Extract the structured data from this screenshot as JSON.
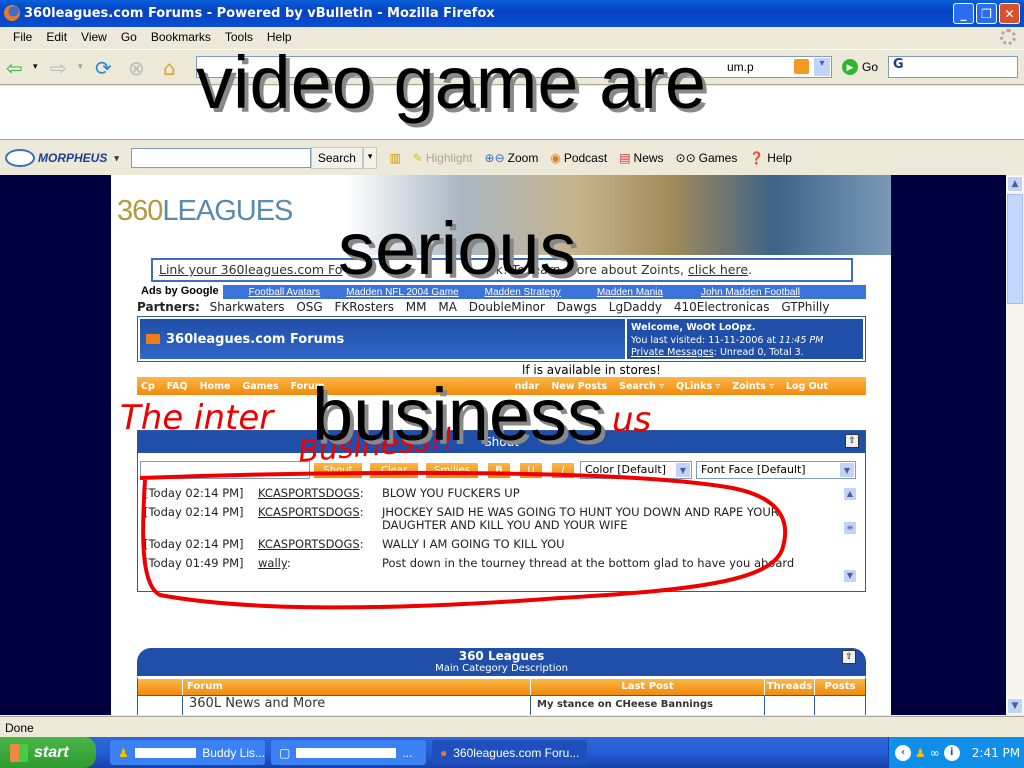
{
  "window": {
    "title": "360leagues.com Forums - Powered by vBulletin - Mozilla Firefox",
    "controls": [
      "minimize",
      "restore",
      "close"
    ]
  },
  "menu": [
    "File",
    "Edit",
    "View",
    "Go",
    "Bookmarks",
    "Tools",
    "Help"
  ],
  "navbar": {
    "url_visible_fragment": "um.p",
    "go_label": "Go",
    "search_engine_icon": "G"
  },
  "morpheus": {
    "brand": "MORPHEUS",
    "search_value": "",
    "search_button": "Search",
    "items": [
      {
        "icon": "toolbar-icon",
        "label": ""
      },
      {
        "icon": "highlight-icon",
        "label": "Highlight"
      },
      {
        "icon": "zoom-icon",
        "label": "Zoom"
      },
      {
        "icon": "podcast-icon",
        "label": "Podcast"
      },
      {
        "icon": "news-icon",
        "label": "News"
      },
      {
        "icon": "games-icon",
        "label": "Games"
      },
      {
        "icon": "help-icon",
        "label": "Help"
      }
    ]
  },
  "page": {
    "logo": {
      "a": "360",
      "b": "LEAGUES"
    },
    "zoints": {
      "text_visible": "Link your 360leagues.com Fo",
      "text_hidden_mid": "rum ... to the Zoints network",
      "text_tail": "rk! To learn more about Zoints, ",
      "link": "click here",
      "end": "."
    },
    "ads": {
      "label": "Ads by Google",
      "links": [
        "Football Avatars",
        "Madden NFL 2004 Game",
        "Madden Strategy",
        "Madden Mania",
        "John Madden Football"
      ]
    },
    "partners": {
      "label": "Partners:",
      "items": [
        "Sharkwaters",
        "OSG",
        "FKRosters",
        "MM",
        "MA",
        "DoubleMinor",
        "Dawgs",
        "LgDaddy",
        "410Electronicas",
        "GTPhilly"
      ]
    },
    "forum_header": {
      "title": "360leagues.com Forums",
      "welcome": "Welcome, WoOt LoOpz.",
      "last_visited_label": "You last visited: 11-11-2006 at ",
      "last_visited_time": "11:45 PM",
      "pm_link": "Private Messages",
      "pm_status": ": Unread 0, Total 3."
    },
    "notice_tail": "lf is available in stores!",
    "nav": [
      "Cp",
      "FAQ",
      "Home",
      "Games",
      "Forum",
      "",
      "",
      "ndar",
      "New Posts",
      "Search ▿",
      "QLinks ▿",
      "Zoints ▿",
      "Log Out"
    ],
    "shoutbox": {
      "title": "Shout",
      "input_value": "",
      "buttons": [
        "Shout",
        "Clear",
        "Smilies",
        "B",
        "U",
        "I"
      ],
      "color_select": "Color [Default]",
      "font_select": "Font Face [Default]",
      "messages": [
        {
          "time": "[Today 02:14 PM]",
          "user": "KCASPORTSDOGS",
          "text": "BLOW YOU FUCKERS UP"
        },
        {
          "time": "[Today 02:14 PM]",
          "user": "KCASPORTSDOGS",
          "text": "JHOCKEY SAID HE WAS GOING TO HUNT YOU DOWN AND RAPE YOUR DAUGHTER AND KILL YOU AND YOUR WIFE"
        },
        {
          "time": "[Today 02:14 PM]",
          "user": "KCASPORTSDOGS",
          "text": "WALLY I AM GOING TO KILL YOU"
        },
        {
          "time": "[Today 01:49 PM]",
          "user": "wally",
          "text": "Post down in the tourney thread at the bottom glad to have you aboard"
        }
      ]
    },
    "category": {
      "title": "360 Leagues",
      "description": "Main Category Description",
      "columns": [
        "",
        "Forum",
        "Last Post",
        "Threads",
        "Posts"
      ],
      "rows": [
        {
          "forum": "360L News and More",
          "last_post": "My stance on CHeese Bannings"
        }
      ]
    }
  },
  "overlay": {
    "line1": "video game are",
    "line2": "serious",
    "line3": "business",
    "red1": "The inter",
    "red1b": "us",
    "red2": "Business!!"
  },
  "status": "Done",
  "taskbar": {
    "start": "start",
    "tasks": [
      {
        "label": "Buddy Lis...",
        "redacted": true,
        "active": false
      },
      {
        "label": "...",
        "redacted": true,
        "active": false
      },
      {
        "label": "360leagues.com Foru...",
        "redacted": false,
        "active": true
      }
    ],
    "clock": "2:41 PM"
  }
}
